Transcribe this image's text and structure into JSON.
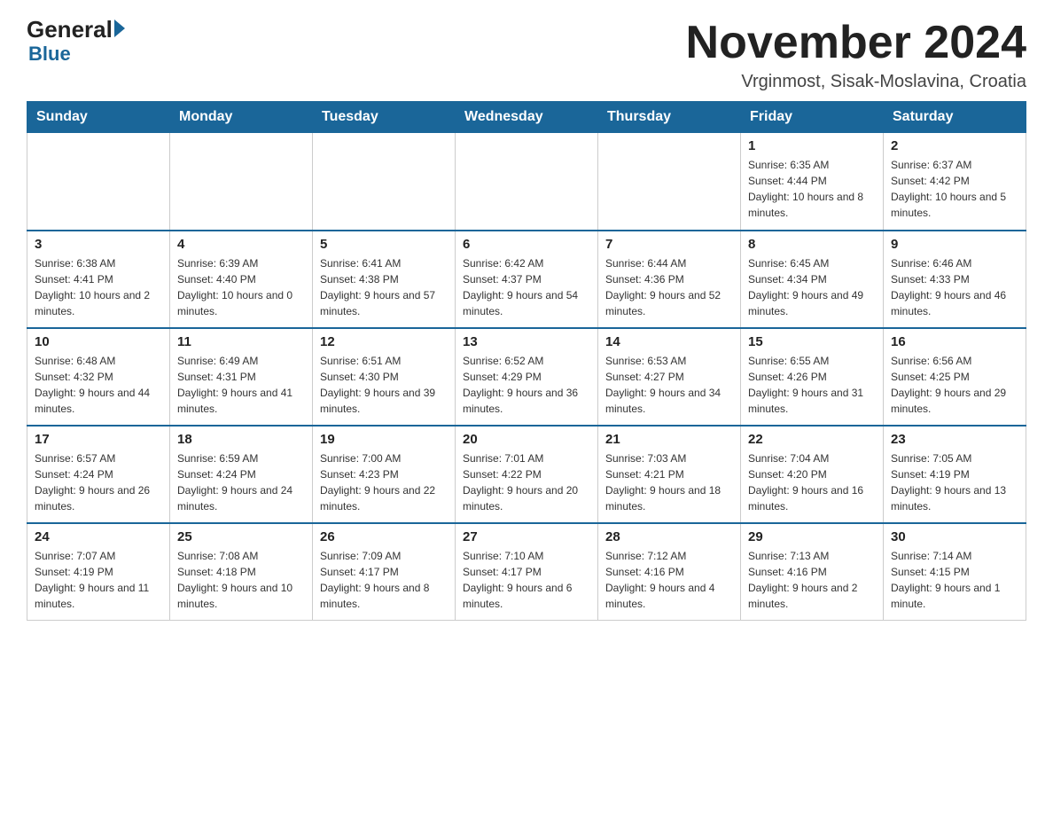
{
  "header": {
    "logo_general": "General",
    "logo_blue": "Blue",
    "month_title": "November 2024",
    "location": "Vrginmost, Sisak-Moslavina, Croatia"
  },
  "weekdays": [
    "Sunday",
    "Monday",
    "Tuesday",
    "Wednesday",
    "Thursday",
    "Friday",
    "Saturday"
  ],
  "weeks": [
    [
      {
        "day": "",
        "info": ""
      },
      {
        "day": "",
        "info": ""
      },
      {
        "day": "",
        "info": ""
      },
      {
        "day": "",
        "info": ""
      },
      {
        "day": "",
        "info": ""
      },
      {
        "day": "1",
        "info": "Sunrise: 6:35 AM\nSunset: 4:44 PM\nDaylight: 10 hours and 8 minutes."
      },
      {
        "day": "2",
        "info": "Sunrise: 6:37 AM\nSunset: 4:42 PM\nDaylight: 10 hours and 5 minutes."
      }
    ],
    [
      {
        "day": "3",
        "info": "Sunrise: 6:38 AM\nSunset: 4:41 PM\nDaylight: 10 hours and 2 minutes."
      },
      {
        "day": "4",
        "info": "Sunrise: 6:39 AM\nSunset: 4:40 PM\nDaylight: 10 hours and 0 minutes."
      },
      {
        "day": "5",
        "info": "Sunrise: 6:41 AM\nSunset: 4:38 PM\nDaylight: 9 hours and 57 minutes."
      },
      {
        "day": "6",
        "info": "Sunrise: 6:42 AM\nSunset: 4:37 PM\nDaylight: 9 hours and 54 minutes."
      },
      {
        "day": "7",
        "info": "Sunrise: 6:44 AM\nSunset: 4:36 PM\nDaylight: 9 hours and 52 minutes."
      },
      {
        "day": "8",
        "info": "Sunrise: 6:45 AM\nSunset: 4:34 PM\nDaylight: 9 hours and 49 minutes."
      },
      {
        "day": "9",
        "info": "Sunrise: 6:46 AM\nSunset: 4:33 PM\nDaylight: 9 hours and 46 minutes."
      }
    ],
    [
      {
        "day": "10",
        "info": "Sunrise: 6:48 AM\nSunset: 4:32 PM\nDaylight: 9 hours and 44 minutes."
      },
      {
        "day": "11",
        "info": "Sunrise: 6:49 AM\nSunset: 4:31 PM\nDaylight: 9 hours and 41 minutes."
      },
      {
        "day": "12",
        "info": "Sunrise: 6:51 AM\nSunset: 4:30 PM\nDaylight: 9 hours and 39 minutes."
      },
      {
        "day": "13",
        "info": "Sunrise: 6:52 AM\nSunset: 4:29 PM\nDaylight: 9 hours and 36 minutes."
      },
      {
        "day": "14",
        "info": "Sunrise: 6:53 AM\nSunset: 4:27 PM\nDaylight: 9 hours and 34 minutes."
      },
      {
        "day": "15",
        "info": "Sunrise: 6:55 AM\nSunset: 4:26 PM\nDaylight: 9 hours and 31 minutes."
      },
      {
        "day": "16",
        "info": "Sunrise: 6:56 AM\nSunset: 4:25 PM\nDaylight: 9 hours and 29 minutes."
      }
    ],
    [
      {
        "day": "17",
        "info": "Sunrise: 6:57 AM\nSunset: 4:24 PM\nDaylight: 9 hours and 26 minutes."
      },
      {
        "day": "18",
        "info": "Sunrise: 6:59 AM\nSunset: 4:24 PM\nDaylight: 9 hours and 24 minutes."
      },
      {
        "day": "19",
        "info": "Sunrise: 7:00 AM\nSunset: 4:23 PM\nDaylight: 9 hours and 22 minutes."
      },
      {
        "day": "20",
        "info": "Sunrise: 7:01 AM\nSunset: 4:22 PM\nDaylight: 9 hours and 20 minutes."
      },
      {
        "day": "21",
        "info": "Sunrise: 7:03 AM\nSunset: 4:21 PM\nDaylight: 9 hours and 18 minutes."
      },
      {
        "day": "22",
        "info": "Sunrise: 7:04 AM\nSunset: 4:20 PM\nDaylight: 9 hours and 16 minutes."
      },
      {
        "day": "23",
        "info": "Sunrise: 7:05 AM\nSunset: 4:19 PM\nDaylight: 9 hours and 13 minutes."
      }
    ],
    [
      {
        "day": "24",
        "info": "Sunrise: 7:07 AM\nSunset: 4:19 PM\nDaylight: 9 hours and 11 minutes."
      },
      {
        "day": "25",
        "info": "Sunrise: 7:08 AM\nSunset: 4:18 PM\nDaylight: 9 hours and 10 minutes."
      },
      {
        "day": "26",
        "info": "Sunrise: 7:09 AM\nSunset: 4:17 PM\nDaylight: 9 hours and 8 minutes."
      },
      {
        "day": "27",
        "info": "Sunrise: 7:10 AM\nSunset: 4:17 PM\nDaylight: 9 hours and 6 minutes."
      },
      {
        "day": "28",
        "info": "Sunrise: 7:12 AM\nSunset: 4:16 PM\nDaylight: 9 hours and 4 minutes."
      },
      {
        "day": "29",
        "info": "Sunrise: 7:13 AM\nSunset: 4:16 PM\nDaylight: 9 hours and 2 minutes."
      },
      {
        "day": "30",
        "info": "Sunrise: 7:14 AM\nSunset: 4:15 PM\nDaylight: 9 hours and 1 minute."
      }
    ]
  ]
}
